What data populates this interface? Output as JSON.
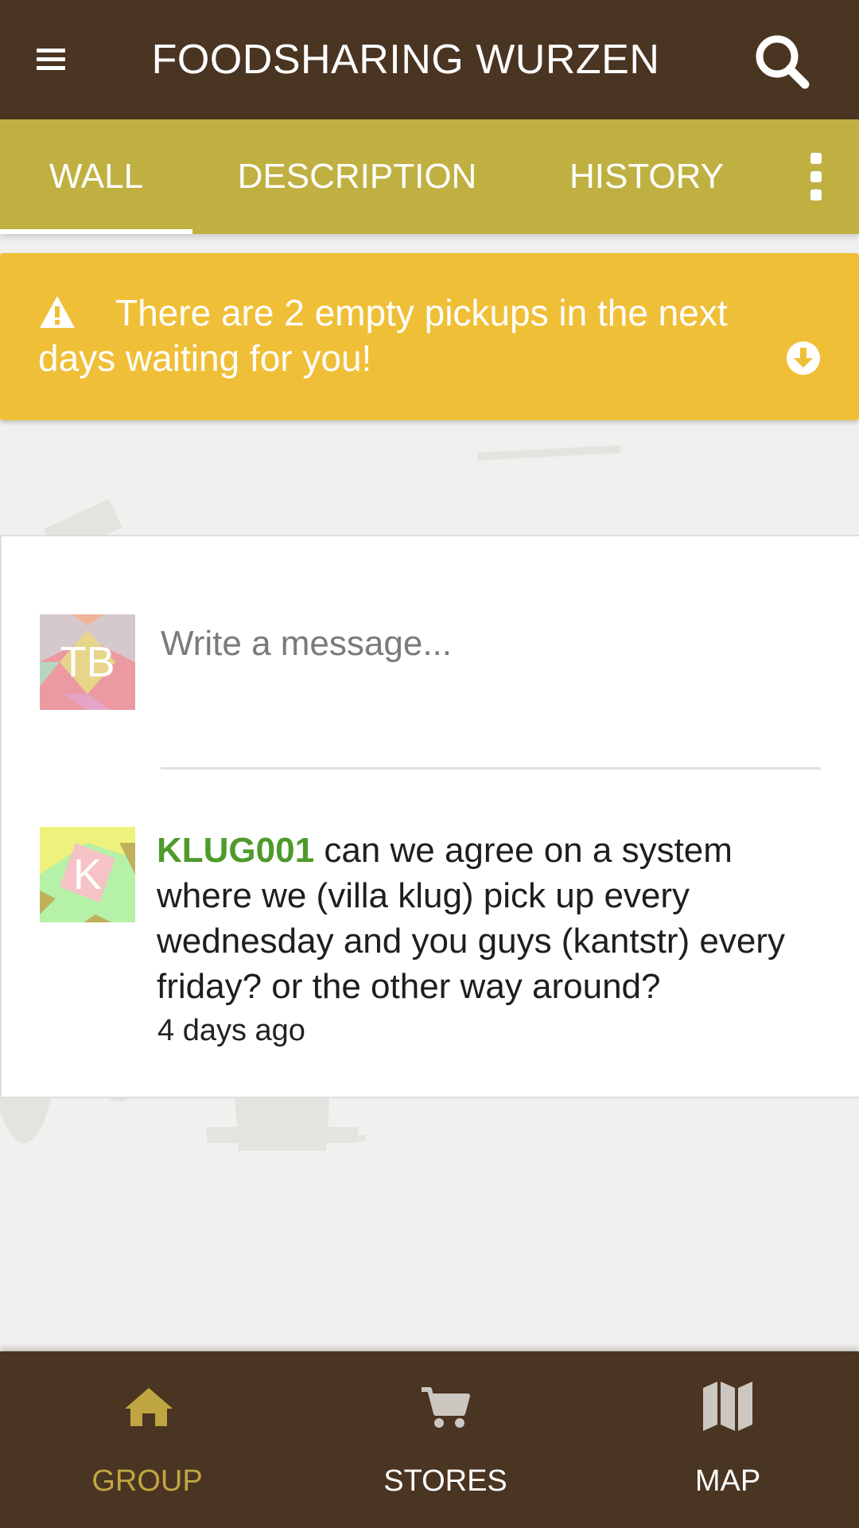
{
  "app": {
    "title": "FOODSHARING WURZEN",
    "brand_color": "#4a3422",
    "tab_color": "#c0b042"
  },
  "tabs": [
    {
      "label": "WALL",
      "active": true
    },
    {
      "label": "DESCRIPTION",
      "active": false
    },
    {
      "label": "HISTORY",
      "active": false
    }
  ],
  "banner": {
    "text": "There are 2 empty pickups in the next days waiting for you!",
    "color": "#f0bf38",
    "icon": "warning-icon"
  },
  "composer": {
    "avatar_initials": "TB",
    "placeholder": "Write a message..."
  },
  "posts": [
    {
      "avatar_initials": "K",
      "author": "KLUG001",
      "text": "can we agree on a system where we (villa klug) pick up every wednesday and you guys (kantstr) every friday? or the other way around?",
      "time": "4 days ago"
    }
  ],
  "bottom_nav": [
    {
      "label": "GROUP",
      "icon": "home-icon",
      "active": true,
      "color": "#c0a642"
    },
    {
      "label": "STORES",
      "icon": "cart-icon",
      "active": false,
      "color": "#ffffff"
    },
    {
      "label": "MAP",
      "icon": "map-icon",
      "active": false,
      "color": "#ffffff"
    }
  ]
}
